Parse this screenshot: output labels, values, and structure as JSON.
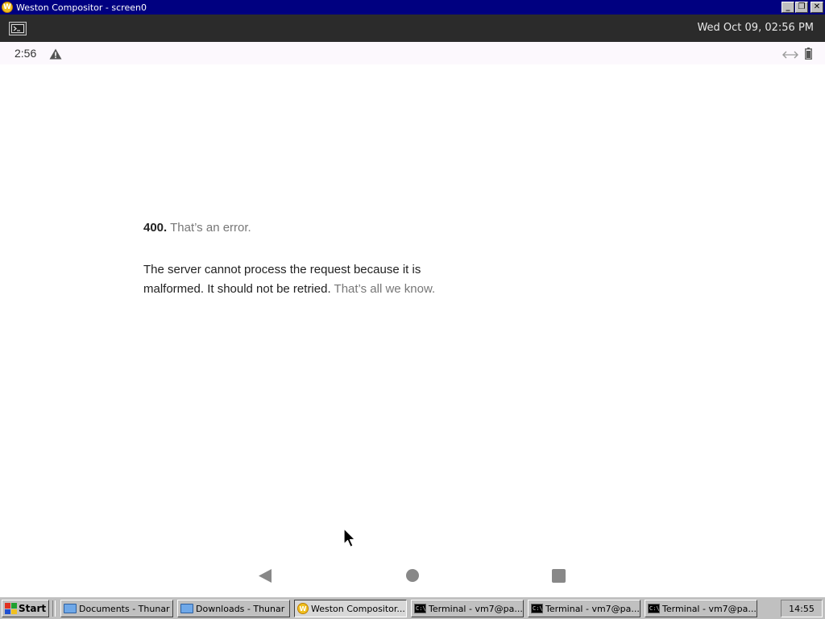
{
  "window": {
    "title": "Weston Compositor - screen0",
    "app_icon_letter": "W",
    "controls": {
      "minimize": "_",
      "maximize": "❐",
      "close": "✕"
    }
  },
  "weston_panel": {
    "launcher_icon": "terminal-icon",
    "clock": "Wed Oct 09, 02:56 PM"
  },
  "status_bar": {
    "time": "2:56",
    "icons": [
      "warning-icon",
      "data-transfer-icon",
      "battery-icon"
    ]
  },
  "error_page": {
    "code": "400.",
    "subtitle": "That’s an error.",
    "message": "The server cannot process the request because it is malformed. It should not be retried.",
    "muted_tail": "That’s all we know."
  },
  "nav_bar": {
    "icons": [
      "back-icon",
      "home-icon",
      "recents-icon"
    ]
  },
  "taskbar": {
    "start_label": "Start",
    "tasks": [
      {
        "label": "Documents - Thunar",
        "icon": "folder-icon",
        "active": false
      },
      {
        "label": "Downloads - Thunar",
        "icon": "folder-icon",
        "active": false
      },
      {
        "label": "Weston Compositor...",
        "icon": "weston-icon",
        "active": true
      },
      {
        "label": "Terminal - vm7@pa...",
        "icon": "terminal-icon",
        "active": false
      },
      {
        "label": "Terminal - vm7@pa...",
        "icon": "terminal-icon",
        "active": false
      },
      {
        "label": "Terminal - vm7@pa...",
        "icon": "terminal-icon",
        "active": false
      }
    ],
    "clock": "14:55"
  },
  "colors": {
    "title_bar": "#000080",
    "panel": "#2b2b2b",
    "status_bar": "#fcf8fd",
    "muted_text": "#777777",
    "taskbar": "#c0c0c0"
  }
}
